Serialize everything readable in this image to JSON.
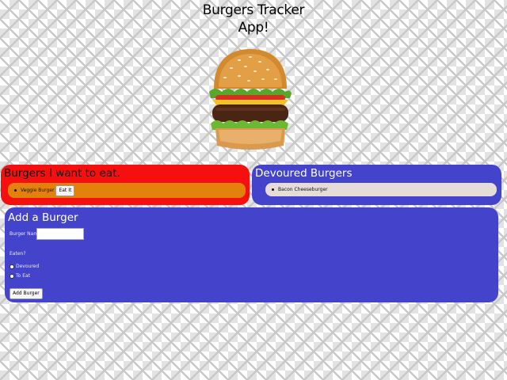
{
  "header": {
    "title_line1": "Burgers Tracker",
    "title_line2": "App!"
  },
  "hero": {
    "image_icon": "hamburger-photo"
  },
  "to_eat": {
    "heading": "Burgers I want to eat.",
    "items": [
      {
        "name": "Veggie Burger",
        "button_label": "Eat It"
      }
    ]
  },
  "devoured": {
    "heading": "Devoured Burgers",
    "items": [
      {
        "name": "Bacon Cheeseburger"
      }
    ]
  },
  "add_form": {
    "heading": "Add a Burger",
    "name_label": "Burger Name:",
    "name_value": "",
    "eaten_label": "Eaten?",
    "option_devoured": "Devoured",
    "option_to_eat": "To Eat",
    "submit_label": "Add Burger"
  },
  "colors": {
    "to_eat_panel": "#f50f0f",
    "to_eat_item": "#e3810d",
    "devoured_panel": "#4343cc",
    "devoured_item": "#e6ddd8",
    "add_panel": "#4343cc"
  }
}
